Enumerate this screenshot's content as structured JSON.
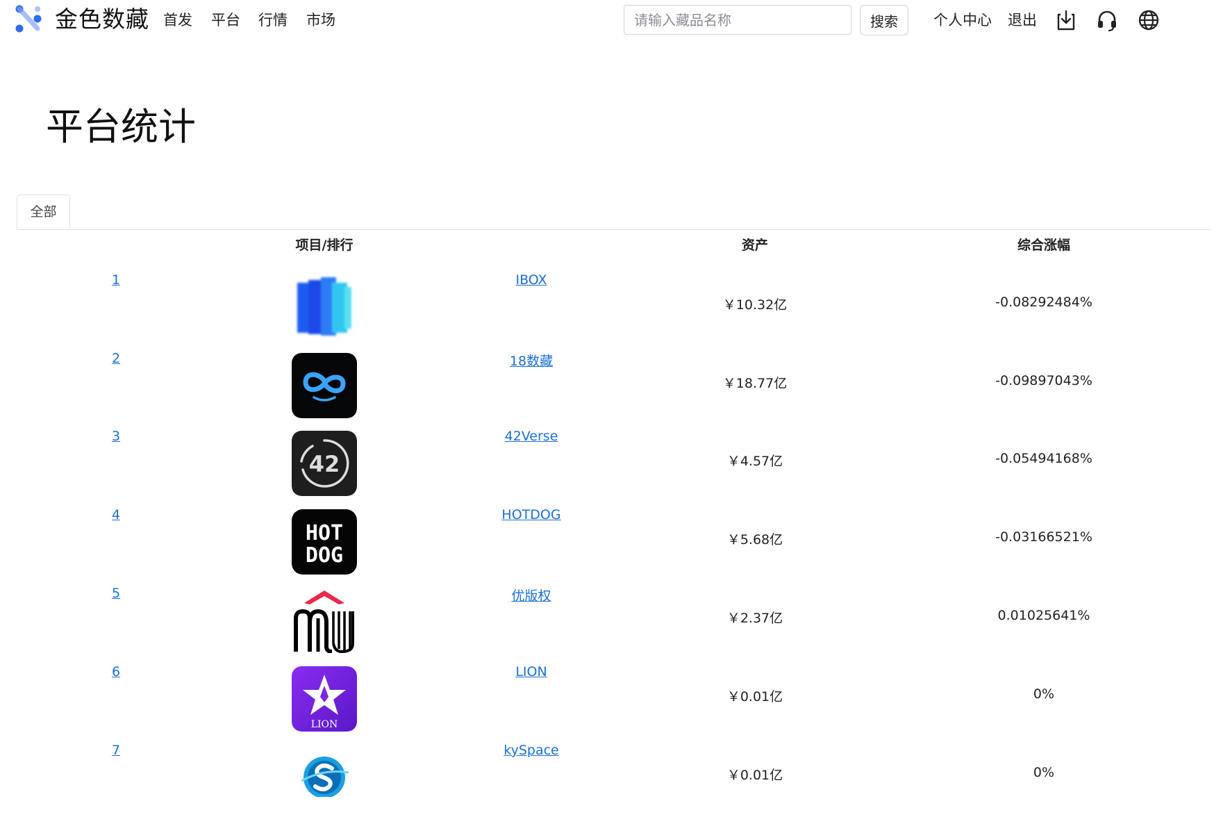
{
  "header": {
    "brand": "金色数藏",
    "nav": [
      "首发",
      "平台",
      "行情",
      "市场"
    ],
    "search": {
      "placeholder": "请输入藏品名称",
      "value": "",
      "button_label": "搜索"
    },
    "user_center": "个人中心",
    "logout": "退出",
    "icons": [
      "download-icon",
      "headset-icon",
      "globe-icon"
    ],
    "accent_color": "#2f6bf2"
  },
  "page": {
    "title": "平台统计",
    "tabs": [
      {
        "label": "全部",
        "active": true
      }
    ]
  },
  "table": {
    "columns": {
      "project_rank": "项目/排行",
      "assets": "资产",
      "change": "综合涨幅"
    },
    "rows": [
      {
        "rank": "1",
        "name": "IBOX",
        "assets": "￥10.32亿",
        "change": "-0.08292484%",
        "logo": "ibox-logo"
      },
      {
        "rank": "2",
        "name": "18数藏",
        "assets": "￥18.77亿",
        "change": "-0.09897043%",
        "logo": "18-logo"
      },
      {
        "rank": "3",
        "name": "42Verse",
        "assets": "￥4.57亿",
        "change": "-0.05494168%",
        "logo": "42verse-logo",
        "logo_text": "42"
      },
      {
        "rank": "4",
        "name": "HOTDOG",
        "assets": "￥5.68亿",
        "change": "-0.03166521%",
        "logo": "hotdog-logo",
        "logo_text": [
          "HOT",
          "DOG"
        ]
      },
      {
        "rank": "5",
        "name": "优版权",
        "assets": "￥2.37亿",
        "change": "0.01025641%",
        "logo": "youbanquan-logo"
      },
      {
        "rank": "6",
        "name": "LION",
        "assets": "￥0.01亿",
        "change": "0%",
        "logo": "lion-logo",
        "logo_text": "LION"
      },
      {
        "rank": "7",
        "name": "kySpace",
        "assets": "￥0.01亿",
        "change": "0%",
        "logo": "kyspace-logo"
      }
    ]
  }
}
